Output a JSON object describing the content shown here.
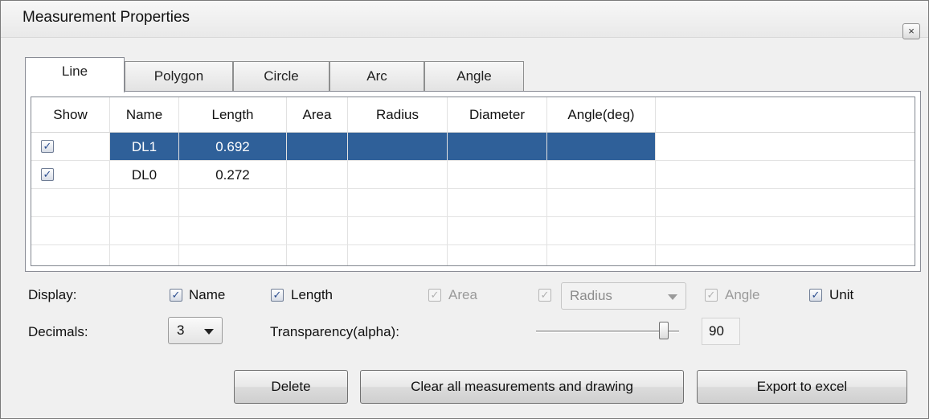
{
  "window": {
    "title": "Measurement Properties",
    "close_symbol": "×"
  },
  "tabs": [
    {
      "label": "Line"
    },
    {
      "label": "Polygon"
    },
    {
      "label": "Circle"
    },
    {
      "label": "Arc"
    },
    {
      "label": "Angle"
    }
  ],
  "active_tab": "Line",
  "table": {
    "columns": [
      "Show",
      "Name",
      "Length",
      "Area",
      "Radius",
      "Diameter",
      "Angle(deg)"
    ],
    "rows": [
      {
        "show": true,
        "name": "DL1",
        "length": "0.692",
        "area": "",
        "radius": "",
        "diameter": "",
        "angle": "",
        "selected": true
      },
      {
        "show": true,
        "name": "DL0",
        "length": "0.272",
        "area": "",
        "radius": "",
        "diameter": "",
        "angle": "",
        "selected": false
      }
    ]
  },
  "display": {
    "label": "Display:",
    "name": {
      "label": "Name",
      "checked": true,
      "enabled": true
    },
    "length": {
      "label": "Length",
      "checked": true,
      "enabled": true
    },
    "area": {
      "label": "Area",
      "checked": true,
      "enabled": false
    },
    "radius": {
      "checked": true,
      "enabled": false,
      "selected": "Radius"
    },
    "angle": {
      "label": "Angle",
      "checked": true,
      "enabled": false
    },
    "unit": {
      "label": "Unit",
      "checked": true,
      "enabled": true
    }
  },
  "decimals": {
    "label": "Decimals:",
    "value": "3"
  },
  "transparency": {
    "label": "Transparency(alpha):",
    "value": "90"
  },
  "buttons": {
    "delete": "Delete",
    "clear_all": "Clear all measurements and drawing",
    "export": "Export to excel"
  },
  "colors": {
    "selection": "#2f6099",
    "window_bg": "#f0f0f0"
  },
  "icons": {
    "check": "checkmark-icon",
    "dropdown": "chevron-down-icon",
    "close": "close-icon"
  }
}
